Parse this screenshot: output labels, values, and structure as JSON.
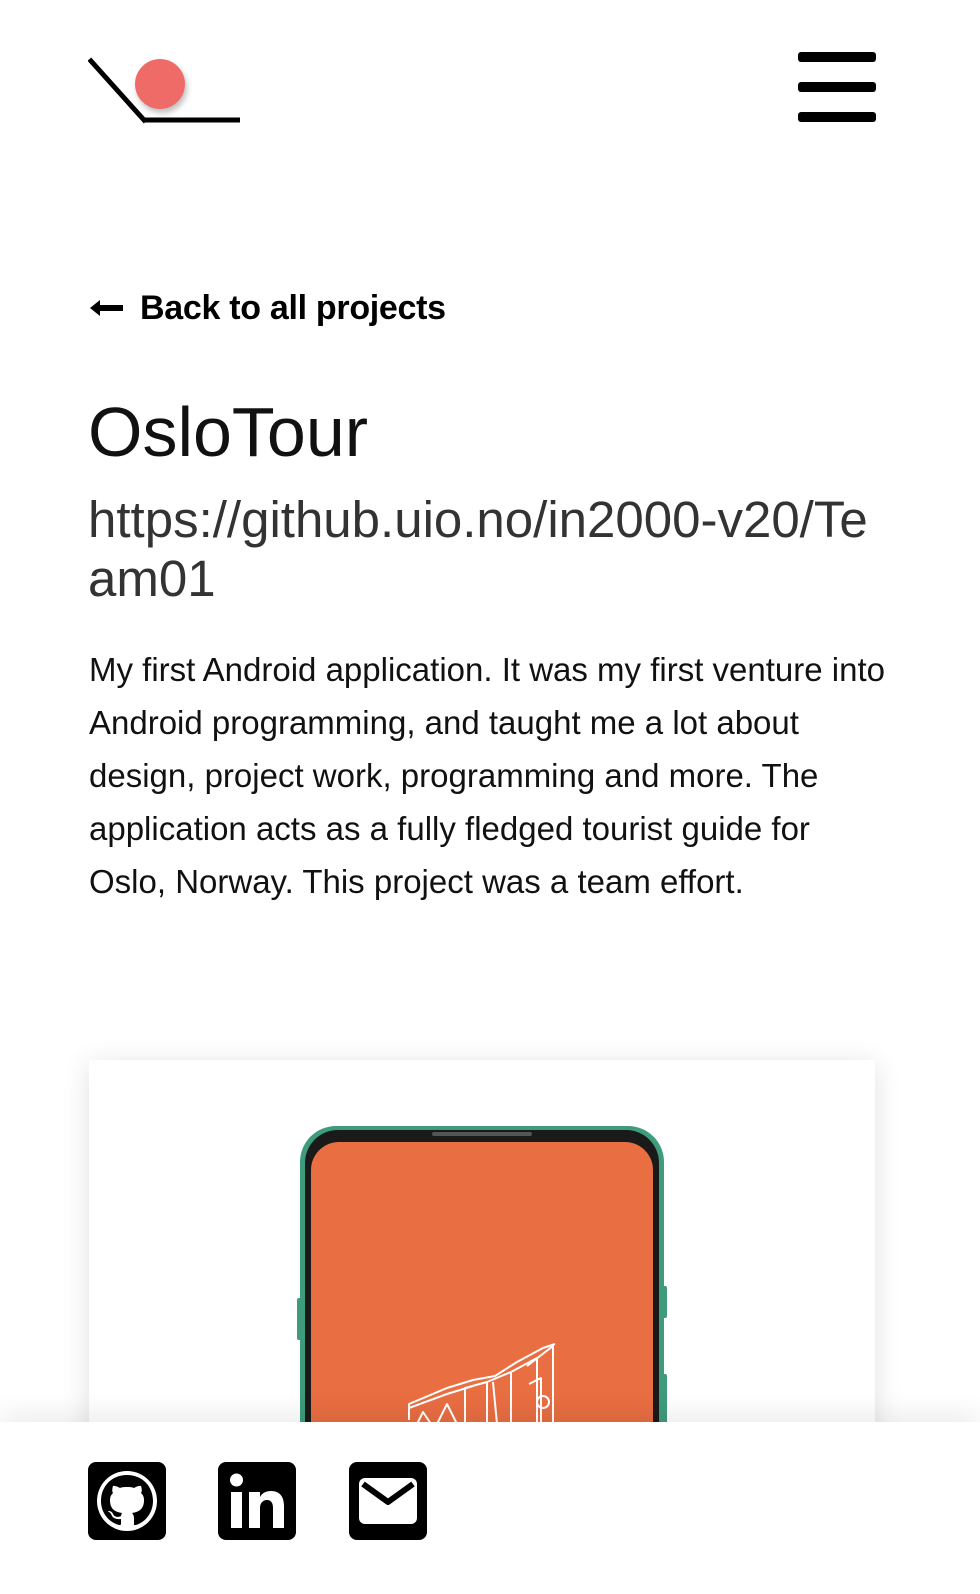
{
  "header": {
    "logo_icon": "site-logo",
    "menu_icon": "hamburger-menu-icon"
  },
  "back": {
    "label": "Back to all projects",
    "icon": "arrow-left-icon"
  },
  "project": {
    "title": "OsloTour",
    "repo_url": "https://github.uio.no/in2000-v20/Team01",
    "description": "My first Android application. It was my first venture into Android programming, and taught me a lot about design, project work, programming and more. The application acts as a fully fledged tourist guide for Oslo, Norway. This project was a team effort.",
    "screenshot_icon": "phone-mockup",
    "screen_color": "#E96E42",
    "frame_color": "#3E9B7B"
  },
  "footer": {
    "links": [
      {
        "icon": "github-icon"
      },
      {
        "icon": "linkedin-icon"
      },
      {
        "icon": "email-icon"
      }
    ]
  },
  "colors": {
    "accent": "#EE6B68",
    "text": "#111111",
    "link": "#333333"
  }
}
